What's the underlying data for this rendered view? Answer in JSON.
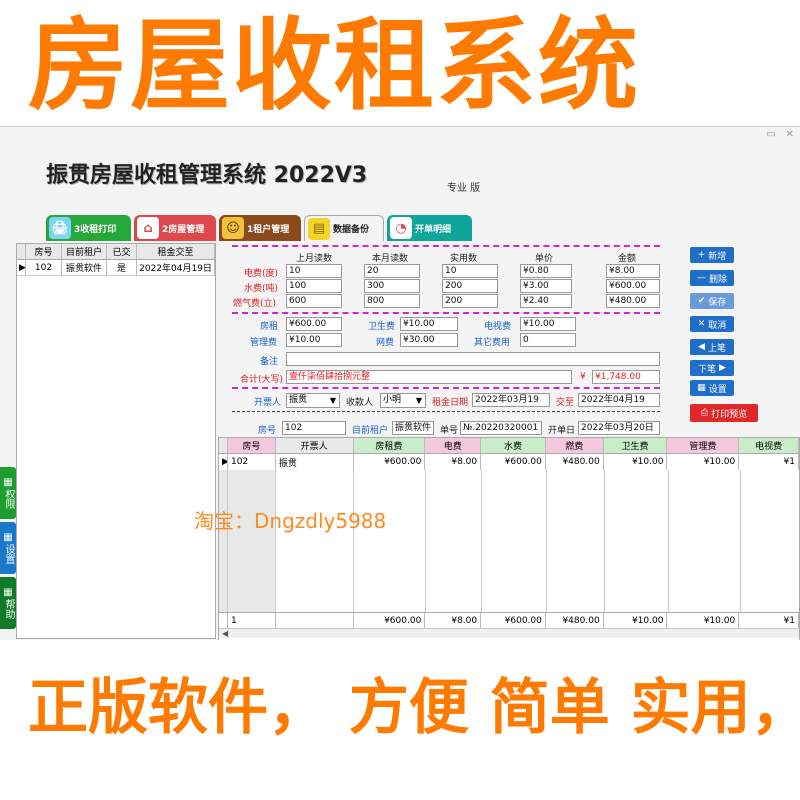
{
  "banner": {
    "title": "房屋收租系统",
    "bottom": "正版软件，   方便 简单 实用，"
  },
  "app": {
    "title": "振贯房屋收租管理系统 2022V3",
    "edition": "专业 版",
    "tabs": [
      {
        "label": "3收租打印",
        "icon": "print-icon"
      },
      {
        "label": "2房屋管理",
        "icon": "house-icon"
      },
      {
        "label": "1租户管理",
        "icon": "people-icon"
      },
      {
        "label": "数据备份",
        "icon": "folder-icon"
      },
      {
        "label": "开单明细",
        "icon": "pie-chart-icon"
      }
    ],
    "side_buttons": [
      {
        "label": "权限"
      },
      {
        "label": "设置"
      },
      {
        "label": "帮助"
      }
    ]
  },
  "left_grid": {
    "headers": [
      "房号",
      "目前租户",
      "已交",
      "租金交至"
    ],
    "rows": [
      {
        "room": "102",
        "tenant": "振贯软件",
        "paid": "是",
        "paid_to": "2022年04月19日"
      }
    ]
  },
  "meter": {
    "headers": [
      "上月读数",
      "本月读数",
      "实用数",
      "单价",
      "金额"
    ],
    "electric": {
      "label": "电费(度)",
      "last": "10",
      "current": "20",
      "used": "10",
      "price": "¥0.80",
      "amount": "¥8.00"
    },
    "water": {
      "label": "水费(吨)",
      "last": "100",
      "current": "300",
      "used": "200",
      "price": "¥3.00",
      "amount": "¥600.00"
    },
    "gas": {
      "label": "燃气费(立)",
      "last": "600",
      "current": "800",
      "used": "200",
      "price": "¥2.40",
      "amount": "¥480.00"
    }
  },
  "fees": {
    "rent_label": "房租",
    "rent": "¥600.00",
    "sanitation_label": "卫生费",
    "sanitation": "¥10.00",
    "tv_label": "电视费",
    "tv": "¥10.00",
    "mgmt_label": "管理费",
    "mgmt": "¥10.00",
    "net_label": "网费",
    "net": "¥30.00",
    "other_label": "其它费用",
    "other": "0",
    "remark_label": "备注",
    "remark": "",
    "total_label": "合计(大写)",
    "total_words": "壹仟柒佰肆拾捌元整",
    "yen": "¥",
    "total": "¥1,748.00"
  },
  "invoice": {
    "issuer_label": "开票人",
    "issuer": "振贯",
    "collector_label": "收款人",
    "collector": "小明",
    "rent_date_label": "租金日期",
    "rent_date": "2022年03月19",
    "to_label": "交至",
    "to_date": "2022年04月19",
    "room_label": "房号",
    "room": "102",
    "tenant_label": "目前租户",
    "tenant": "振贯软件",
    "no_label": "单号",
    "no": "№.20220320001",
    "open_label": "开单日",
    "open_date": "2022年03月20日"
  },
  "actions": [
    {
      "label": "新增",
      "icon": "plus-icon"
    },
    {
      "label": "删除",
      "icon": "minus-icon"
    },
    {
      "label": "保存",
      "icon": "check-icon"
    },
    {
      "label": "取消",
      "icon": "close-icon"
    },
    {
      "label": "上笔",
      "icon": "arrow-left-icon"
    },
    {
      "label": "下笔",
      "icon": "arrow-right-icon"
    },
    {
      "label": "设置",
      "icon": "grid-icon"
    },
    {
      "label": "打印预览",
      "icon": "print-icon"
    }
  ],
  "bottom_grid": {
    "headers": [
      "房号",
      "开票人",
      "房租费",
      "电费",
      "水费",
      "燃费",
      "卫生费",
      "管理费",
      "电视费"
    ],
    "row": {
      "room": "102",
      "issuer": "振贯",
      "rent": "¥600.00",
      "electric": "¥8.00",
      "water": "¥600.00",
      "gas": "¥480.00",
      "sanitation": "¥10.00",
      "mgmt": "¥10.00",
      "tv": "¥1"
    },
    "footer": {
      "count": "1",
      "rent": "¥600.00",
      "electric": "¥8.00",
      "water": "¥600.00",
      "gas": "¥480.00",
      "sanitation": "¥10.00",
      "mgmt": "¥10.00",
      "tv": "¥1"
    }
  },
  "watermark": "淘宝：Dngzdly5988",
  "colors": {
    "banner": "#ff7a00",
    "accent_blue": "#1f6ec7",
    "separator": "#d028c8"
  }
}
